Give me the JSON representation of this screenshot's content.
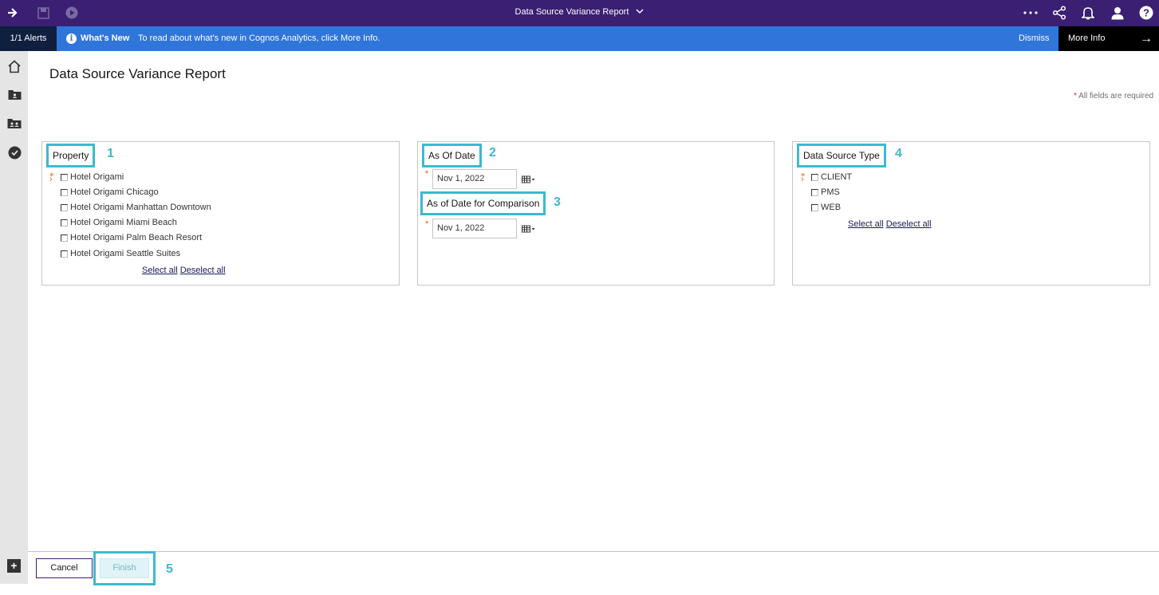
{
  "topbar": {
    "title": "Data Source Variance Report",
    "icons": [
      "arrow-right-icon",
      "save-icon",
      "run-icon",
      "more-icon",
      "share-icon",
      "notification-icon",
      "user-icon",
      "help-icon"
    ]
  },
  "alertbar": {
    "count": "1/1 Alerts",
    "title": "What's New",
    "message": "To read about what's new in Cognos Analytics, click More Info.",
    "dismiss": "Dismiss",
    "more_info": "More Info"
  },
  "page": {
    "title": "Data Source Variance Report",
    "required_note": "All fields are required",
    "required_star": "*"
  },
  "property": {
    "label": "Property",
    "step": "1",
    "options": [
      "Hotel Origami",
      "Hotel Origami Chicago",
      "Hotel Origami Manhattan Downtown",
      "Hotel Origami Miami Beach",
      "Hotel Origami Palm Beach Resort",
      "Hotel Origami Seattle Suites"
    ],
    "select_all": "Select all",
    "deselect_all": "Deselect all"
  },
  "as_of_date": {
    "label": "As Of Date",
    "step": "2",
    "value": "Nov 1, 2022"
  },
  "comparison_date": {
    "label": "As of Date for Comparison",
    "step": "3",
    "value": "Nov 1, 2022"
  },
  "data_source_type": {
    "label": "Data Source Type",
    "step": "4",
    "options": [
      "CLIENT",
      "PMS",
      "WEB"
    ],
    "select_all": "Select all",
    "deselect_all": "Deselect all"
  },
  "footer": {
    "cancel": "Cancel",
    "finish": "Finish",
    "step": "5"
  },
  "colors": {
    "topbar": "#3b1f73",
    "alertbar": "#2f75da",
    "highlight": "#3cb9d0",
    "required": "#ff5c00"
  }
}
